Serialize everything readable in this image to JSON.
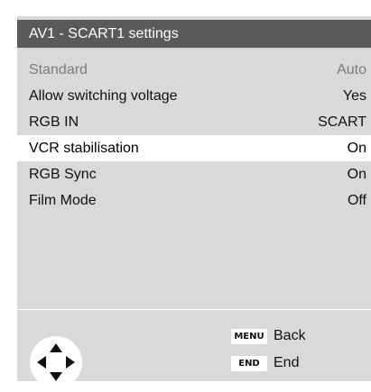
{
  "title": "AV1 - SCART1 settings",
  "settings": [
    {
      "label": "Standard",
      "value": "Auto",
      "state": "disabled"
    },
    {
      "label": "Allow switching voltage",
      "value": "Yes",
      "state": "normal"
    },
    {
      "label": "RGB IN",
      "value": "SCART",
      "state": "normal"
    },
    {
      "label": "VCR stabilisation",
      "value": "On",
      "state": "selected"
    },
    {
      "label": "RGB Sync",
      "value": "On",
      "state": "normal"
    },
    {
      "label": "Film Mode",
      "value": "Off",
      "state": "normal"
    }
  ],
  "footer": {
    "navigation_icon": "four-way-arrows-icon",
    "hints": [
      {
        "key": "MENU",
        "label": "Back"
      },
      {
        "key": "END",
        "label": "End"
      }
    ]
  },
  "colors": {
    "title_bar": "#595a5c",
    "panel": "#d9d9da",
    "selected_row": "#ffffff",
    "disabled_text": "#7b7b7c"
  }
}
